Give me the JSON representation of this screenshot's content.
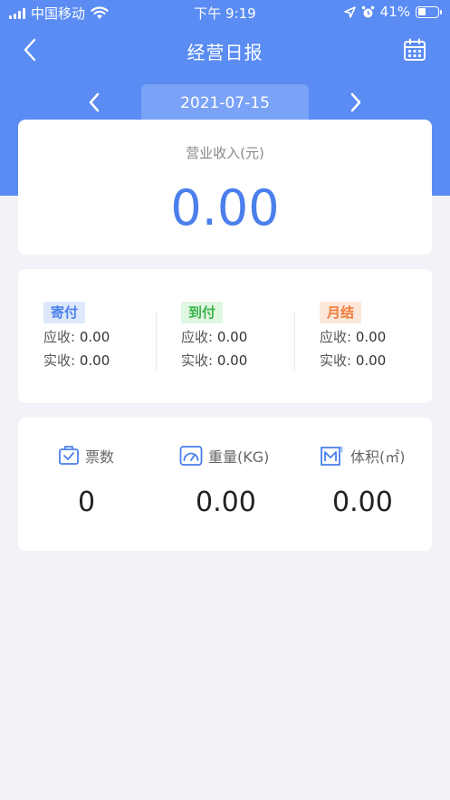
{
  "status_bar": {
    "carrier": "中国移动",
    "time": "下午 9:19",
    "battery": "41%",
    "battery_level": 0.41
  },
  "nav": {
    "title": "经营日报",
    "back_icon": "back-icon",
    "calendar_icon": "calendar-icon"
  },
  "date": {
    "value": "2021-07-15",
    "prev_icon": "chevron-left-icon",
    "next_icon": "chevron-right-icon"
  },
  "revenue": {
    "label": "营业收入(元)",
    "value": "0.00"
  },
  "payments": [
    {
      "tag": "寄付",
      "receivable_label": "应收:",
      "receivable": "0.00",
      "received_label": "实收:",
      "received": "0.00",
      "color": "#4a7fec"
    },
    {
      "tag": "到付",
      "receivable_label": "应收:",
      "receivable": "0.00",
      "received_label": "实收:",
      "received": "0.00",
      "color": "#3bb54a"
    },
    {
      "tag": "月结",
      "receivable_label": "应收:",
      "receivable": "0.00",
      "received_label": "实收:",
      "received": "0.00",
      "color": "#ef7b3a"
    }
  ],
  "stats": [
    {
      "icon": "ticket-box-icon",
      "label": "票数",
      "value": "0"
    },
    {
      "icon": "gauge-icon",
      "label": "重量(KG)",
      "value": "0.00"
    },
    {
      "icon": "volume-m3-icon",
      "label": "体积(㎡)",
      "value": "0.00"
    }
  ],
  "colors": {
    "header_blue": "#5a8cf3",
    "accent_blue": "#4a7fec",
    "background": "#f1f3f8"
  }
}
